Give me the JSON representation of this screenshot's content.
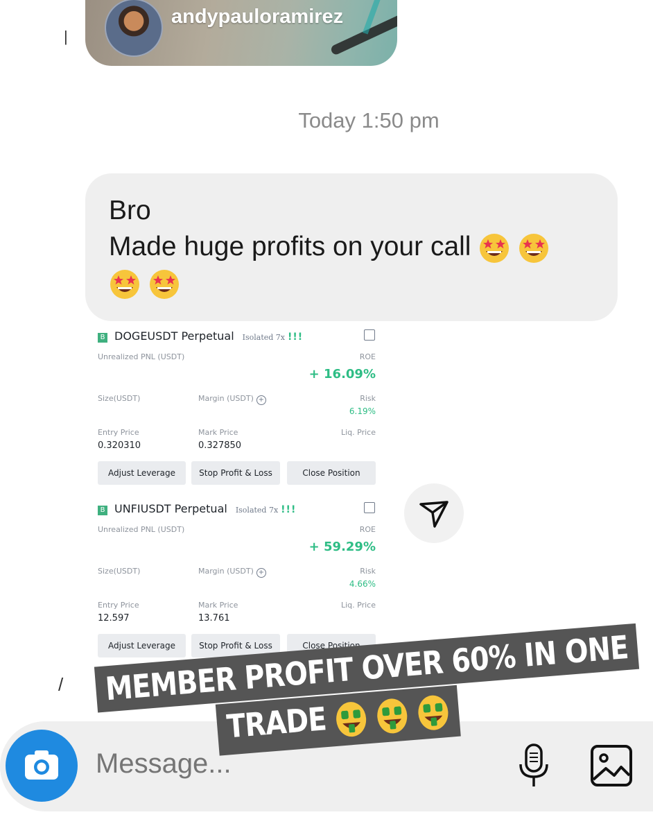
{
  "story": {
    "username": "andypauloramirez"
  },
  "timestamp": "Today 1:50 pm",
  "message": {
    "line1": "Bro",
    "line2": "Made huge profits on your call",
    "emoji": "star-struck-face"
  },
  "positions": [
    {
      "symbol": "DOGEUSDT Perpetual",
      "margin_mode": "Isolated 7x",
      "bars": "!!!",
      "unrealized_label": "Unrealized PNL (USDT)",
      "roe_label": "ROE",
      "roe": "+ 16.09%",
      "size_label": "Size(USDT)",
      "margin_label": "Margin (USDT)",
      "risk_label": "Risk",
      "risk": "6.19%",
      "entry_label": "Entry Price",
      "entry": "0.320310",
      "mark_label": "Mark Price",
      "mark": "0.327850",
      "liq_label": "Liq. Price",
      "btn_leverage": "Adjust Leverage",
      "btn_tpsl": "Stop Profit & Loss",
      "btn_close": "Close Position"
    },
    {
      "symbol": "UNFIUSDT Perpetual",
      "margin_mode": "Isolated 7x",
      "bars": "!!!",
      "unrealized_label": "Unrealized PNL (USDT)",
      "roe_label": "ROE",
      "roe": "+ 59.29%",
      "size_label": "Size(USDT)",
      "margin_label": "Margin (USDT)",
      "risk_label": "Risk",
      "risk": "4.66%",
      "entry_label": "Entry Price",
      "entry": "12.597",
      "mark_label": "Mark Price",
      "mark": "13.761",
      "liq_label": "Liq. Price",
      "btn_leverage": "Adjust Leverage",
      "btn_tpsl": "Stop Profit & Loss",
      "btn_close": "Close Position"
    }
  ],
  "caption": {
    "line1": "MEMBER PROFIT OVER 60% IN ONE",
    "line2": "TRADE",
    "emoji": "money-mouth-face"
  },
  "composer": {
    "placeholder": "Message..."
  },
  "colors": {
    "accent_blue": "#1f8ae0",
    "profit_green": "#2ebd85",
    "bubble_gray": "#efefef"
  }
}
